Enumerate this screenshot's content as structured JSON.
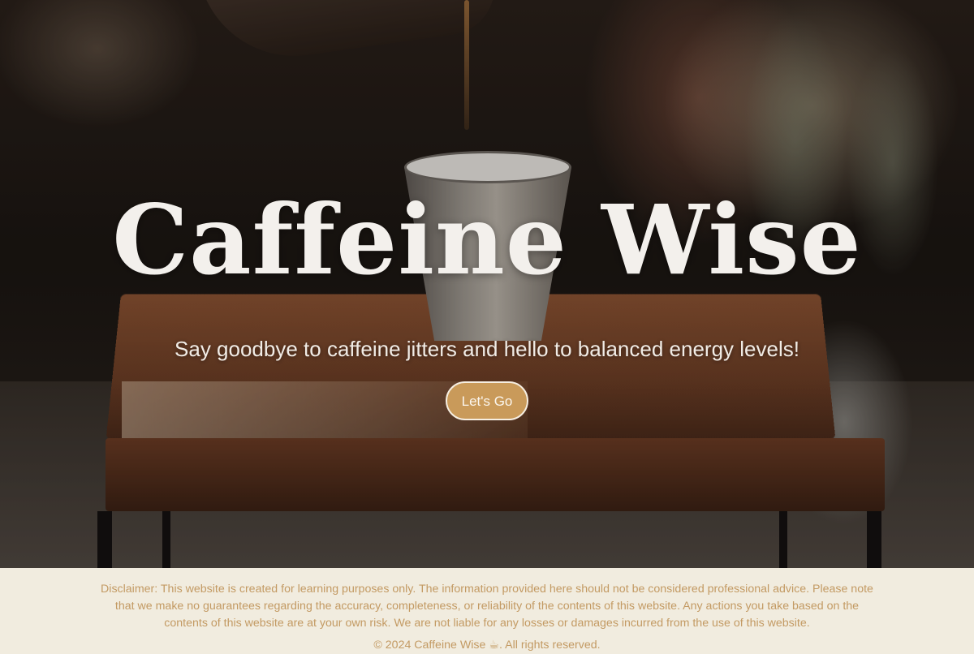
{
  "hero": {
    "title": "Caffeine Wise",
    "subtitle": "Say goodbye to caffeine jitters and hello to balanced energy levels!",
    "cta_label": "Let's Go"
  },
  "footer": {
    "disclaimer": "Disclaimer: This website is created for learning purposes only. The information provided here should not be considered professional advice. Please note that we make no guarantees regarding the accuracy, completeness, or reliability of the contents of this website. Any actions you take based on the contents of this website are at your own risk. We are not liable for any losses or damages incurred from the use of this website.",
    "copyright": "© 2024 Caffeine Wise ☕. All rights reserved."
  },
  "colors": {
    "accent": "#c99a5a",
    "footer_bg": "#f1ecdf",
    "footer_text": "#c39a63"
  }
}
